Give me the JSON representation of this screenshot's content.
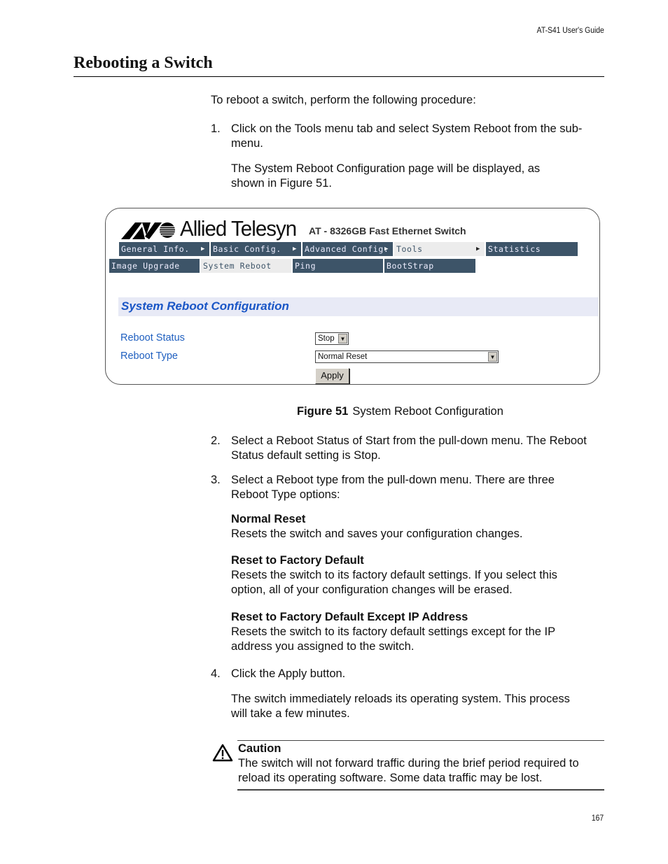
{
  "header": {
    "running_head": "AT-S41 User's Guide",
    "section_title": "Rebooting a Switch"
  },
  "intro": "To reboot a switch, perform the following procedure:",
  "steps": [
    {
      "num": "1.",
      "text": [
        "Click on the Tools menu tab and select System Reboot from the sub-",
        "menu."
      ]
    },
    {
      "num": "",
      "text": [
        "The System Reboot Configuration page will be displayed, as",
        "shown in Figure 51."
      ]
    }
  ],
  "figure": {
    "brand": "Allied Telesyn",
    "product": "AT - 8326GB Fast Ethernet Switch",
    "menu_top": [
      {
        "label": "General Info.",
        "arrow": true,
        "active": false
      },
      {
        "label": "Basic Config.",
        "arrow": true,
        "active": false
      },
      {
        "label": "Advanced Config.",
        "arrow": true,
        "active": false
      },
      {
        "label": "Tools",
        "arrow": true,
        "active": true
      },
      {
        "label": "Statistics",
        "arrow": false,
        "active": false
      }
    ],
    "menu_sub": [
      {
        "label": "Image Upgrade",
        "active": false
      },
      {
        "label": "System Reboot",
        "active": true
      },
      {
        "label": "Ping",
        "active": false
      },
      {
        "label": "BootStrap",
        "active": false
      }
    ],
    "config_title": "System Reboot Configuration",
    "fields": [
      {
        "label": "Reboot Status",
        "value": "Stop"
      },
      {
        "label": "Reboot Type",
        "value": "Normal Reset"
      }
    ],
    "apply_label": "Apply",
    "colors": {
      "menu_bg": "#3d5468",
      "title_blue": "#1a56c6",
      "band_bg": "#e8eaf6"
    }
  },
  "caption": {
    "label": "Figure 51",
    "text": "System Reboot Configuration"
  },
  "steps2": [
    {
      "num": "2.",
      "text": [
        "Select a Reboot Status of Start from the pull-down menu. The Reboot",
        "Status default setting is Stop."
      ]
    },
    {
      "num": "3.",
      "text": [
        "Select a Reboot type from the pull-down menu. There are three",
        "Reboot Type options:"
      ]
    }
  ],
  "options": [
    {
      "title": "Normal Reset",
      "text": [
        "Resets the switch and saves your configuration changes."
      ]
    },
    {
      "title": "Reset to Factory Default",
      "text": [
        "Resets the switch to its factory default settings. If you select this",
        "option, all of your configuration changes will be erased."
      ]
    },
    {
      "title": "Reset to Factory Default Except IP Address",
      "text": [
        "Resets the switch to its factory default settings except for the IP",
        "address you assigned to the switch."
      ]
    }
  ],
  "step4": {
    "num": "4.",
    "text": "Click the Apply button."
  },
  "step4_note": [
    "The switch immediately reloads its operating system. This process",
    "will take a few minutes."
  ],
  "caution": {
    "title": "Caution",
    "text": [
      "The switch will not forward traffic during the brief period required to",
      "reload its operating software. Some data traffic may be lost."
    ]
  },
  "page_number": "167"
}
